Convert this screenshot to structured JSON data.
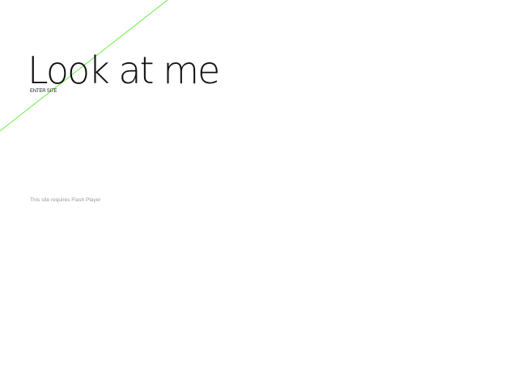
{
  "header": {
    "title": "Look at me",
    "enter_link": "ENTER SITE"
  },
  "notice": {
    "text": "This site requires Flash Player"
  },
  "colors": {
    "background": "#ffffff",
    "title": "#111111",
    "notice": "#9a9a9a",
    "decorative_line": "#66ee44"
  }
}
